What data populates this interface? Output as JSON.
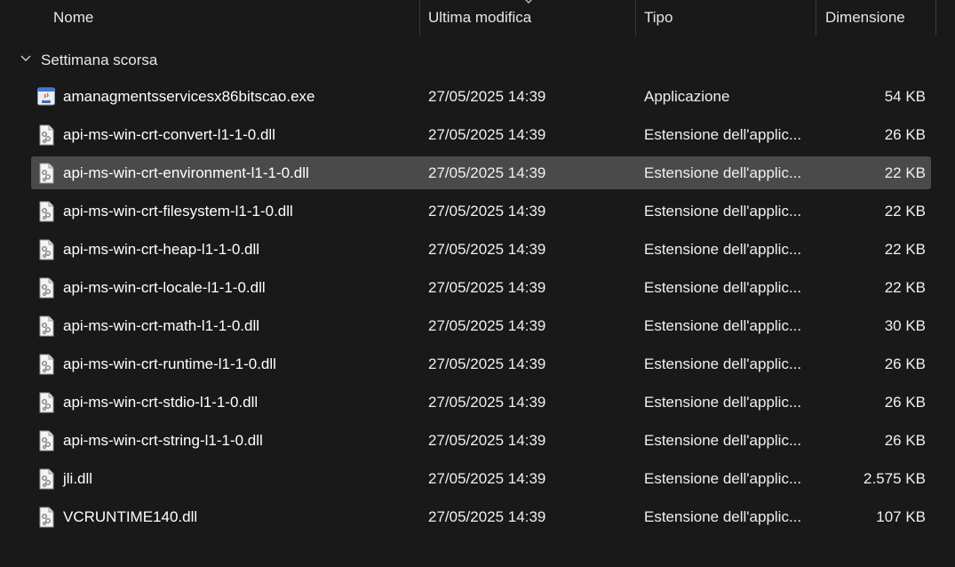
{
  "columns": {
    "name": "Nome",
    "modified": "Ultima modifica",
    "type": "Tipo",
    "size": "Dimensione"
  },
  "group": {
    "label": "Settimana scorsa",
    "icon": "chevron-down-icon"
  },
  "files": [
    {
      "name": "amanagmentsservicesx86bitscao.exe",
      "modified": "27/05/2025 14:39",
      "type": "Applicazione",
      "size": "54 KB",
      "icon": "exe-java-icon"
    },
    {
      "name": "api-ms-win-crt-convert-l1-1-0.dll",
      "modified": "27/05/2025 14:39",
      "type": "Estensione dell'applic...",
      "size": "26 KB",
      "icon": "dll-file-icon"
    },
    {
      "name": "api-ms-win-crt-environment-l1-1-0.dll",
      "modified": "27/05/2025 14:39",
      "type": "Estensione dell'applic...",
      "size": "22 KB",
      "icon": "dll-file-icon",
      "selected": true
    },
    {
      "name": "api-ms-win-crt-filesystem-l1-1-0.dll",
      "modified": "27/05/2025 14:39",
      "type": "Estensione dell'applic...",
      "size": "22 KB",
      "icon": "dll-file-icon"
    },
    {
      "name": "api-ms-win-crt-heap-l1-1-0.dll",
      "modified": "27/05/2025 14:39",
      "type": "Estensione dell'applic...",
      "size": "22 KB",
      "icon": "dll-file-icon"
    },
    {
      "name": "api-ms-win-crt-locale-l1-1-0.dll",
      "modified": "27/05/2025 14:39",
      "type": "Estensione dell'applic...",
      "size": "22 KB",
      "icon": "dll-file-icon"
    },
    {
      "name": "api-ms-win-crt-math-l1-1-0.dll",
      "modified": "27/05/2025 14:39",
      "type": "Estensione dell'applic...",
      "size": "30 KB",
      "icon": "dll-file-icon"
    },
    {
      "name": "api-ms-win-crt-runtime-l1-1-0.dll",
      "modified": "27/05/2025 14:39",
      "type": "Estensione dell'applic...",
      "size": "26 KB",
      "icon": "dll-file-icon"
    },
    {
      "name": "api-ms-win-crt-stdio-l1-1-0.dll",
      "modified": "27/05/2025 14:39",
      "type": "Estensione dell'applic...",
      "size": "26 KB",
      "icon": "dll-file-icon"
    },
    {
      "name": "api-ms-win-crt-string-l1-1-0.dll",
      "modified": "27/05/2025 14:39",
      "type": "Estensione dell'applic...",
      "size": "26 KB",
      "icon": "dll-file-icon"
    },
    {
      "name": "jli.dll",
      "modified": "27/05/2025 14:39",
      "type": "Estensione dell'applic...",
      "size": "2.575 KB",
      "icon": "dll-file-icon"
    },
    {
      "name": "VCRUNTIME140.dll",
      "modified": "27/05/2025 14:39",
      "type": "Estensione dell'applic...",
      "size": "107 KB",
      "icon": "dll-file-icon"
    }
  ],
  "colors": {
    "background": "#191919",
    "selected_row": "#4a4a4a",
    "text": "#ffffff"
  }
}
